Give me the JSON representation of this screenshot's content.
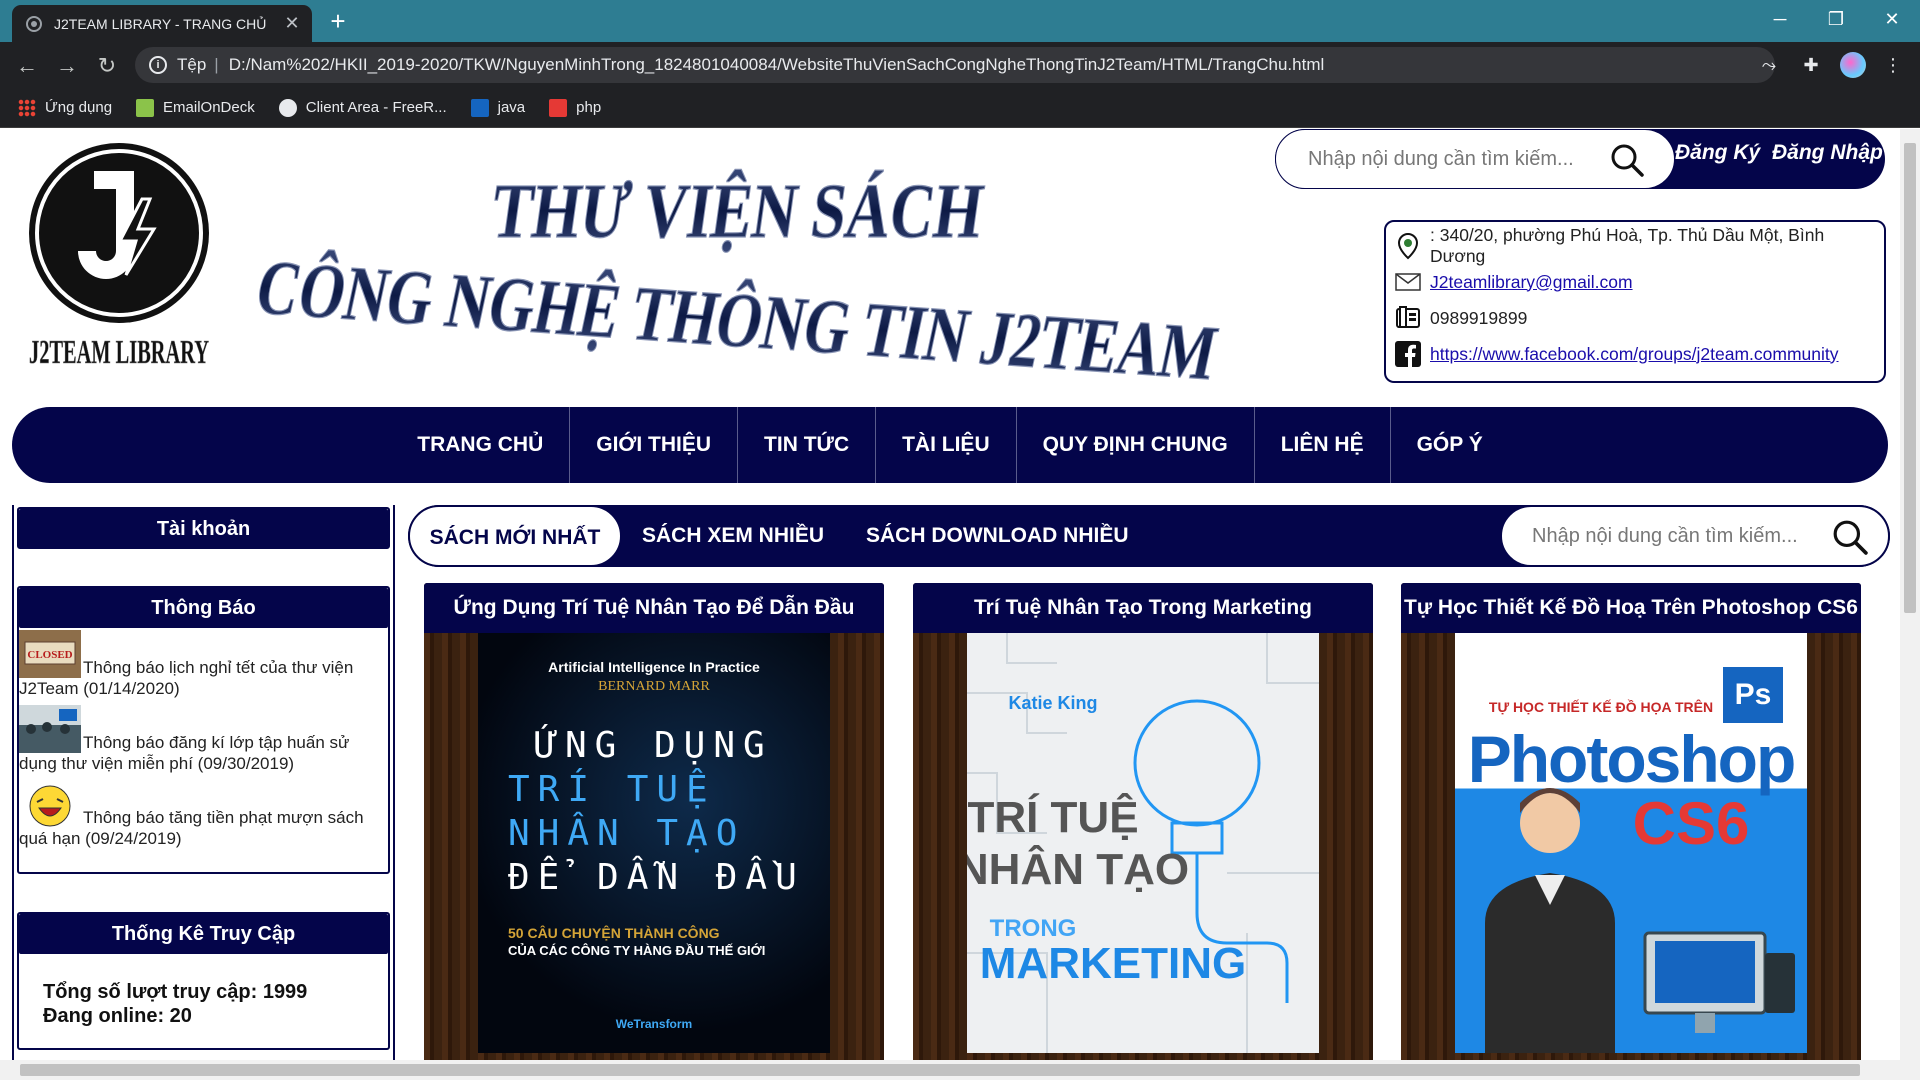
{
  "browser": {
    "tab_title": "J2TEAM LIBRARY - TRANG CHỦ",
    "address_scheme": "Tệp",
    "address_url": "D:/Nam%202/HKII_2019-2020/TKW/NguyenMinhTrong_1824801040084/WebsiteThuVienSachCongNgheThongTinJ2Team/HTML/TrangChu.html",
    "bookmarks": [
      "Ứng dụng",
      "EmailOnDeck",
      "Client Area - FreeR...",
      "java",
      "php"
    ]
  },
  "header": {
    "logo_text": "J2TEAM LIBRARY",
    "hero_line1": "THƯ VIỆN SÁCH",
    "hero_line2": "CÔNG NGHỆ THÔNG TIN J2TEAM",
    "search_placeholder": "Nhập nội dung cần tìm kiếm...",
    "register": "Đăng Ký",
    "login": "Đăng Nhập",
    "contact": {
      "address": ": 340/20, phường Phú Hoà, Tp. Thủ Dầu Một, Bình Dương",
      "email": "J2teamlibrary@gmail.com",
      "phone": "0989919899",
      "facebook": "https://www.facebook.com/groups/j2team.community"
    }
  },
  "nav": [
    "TRANG CHỦ",
    "GIỚI THIỆU",
    "TIN TỨC",
    "TÀI LIỆU",
    "QUY ĐỊNH CHUNG",
    "LIÊN HỆ",
    "GÓP Ý"
  ],
  "sidebar": {
    "account_title": "Tài khoản",
    "notice_title": "Thông Báo",
    "notices": [
      "Thông báo lịch nghỉ tết của thư viện J2Team (01/14/2020)",
      "Thông báo đăng kí lớp tập huấn sử dụng thư viện miễn phí (09/30/2019)",
      "Thông báo tăng tiền phạt mượn sách quá hạn (09/24/2019)"
    ],
    "notice_thumb_label": "CLOSED",
    "stats_title": "Thống Kê Truy Cập",
    "total_visits": "Tổng số lượt truy cập: 1999",
    "online": "Đang online: 20"
  },
  "content": {
    "tabs": [
      "SÁCH MỚI NHẤT",
      "SÁCH XEM NHIỀU",
      "SÁCH DOWNLOAD NHIỀU"
    ],
    "search_placeholder": "Nhập nội dung cần tìm kiếm...",
    "books": [
      {
        "title": "Ứng Dụng Trí Tuệ Nhân Tạo Để Dẫn Đầu",
        "cover_top": "Artificial Intelligence In Practice",
        "cover_author": "BERNARD MARR",
        "cover_l1": "ỨNG DỤNG",
        "cover_l2": "TRÍ TUỆ",
        "cover_l3": "NHÂN TẠO",
        "cover_l4": "ĐỂ DẪN ĐẦU",
        "cover_sub1": "50 CÂU CHUYỆN THÀNH CÔNG",
        "cover_sub2": "CỦA CÁC CÔNG TY HÀNG ĐẦU THẾ GIỚI",
        "cover_pub": "WeTransform"
      },
      {
        "title": "Trí Tuệ Nhân Tạo Trong Marketing",
        "cover_author": "Katie King",
        "cover_l1": "TRÍ TUỆ",
        "cover_l2": "NHÂN TẠO",
        "cover_l3": "TRONG",
        "cover_l4": "MARKETING"
      },
      {
        "title": "Tự Học Thiết Kế Đồ Hoạ Trên Photoshop CS6",
        "cover_top": "TỰ HỌC THIẾT KẾ ĐỒ HỌA TRÊN",
        "cover_ps": "Ps",
        "cover_l1": "Photoshop",
        "cover_l2": "CS6"
      }
    ]
  },
  "colors": {
    "navy": "#04054a",
    "chrome_tab_strip": "#2e7d92",
    "chrome_dark": "#202124"
  }
}
